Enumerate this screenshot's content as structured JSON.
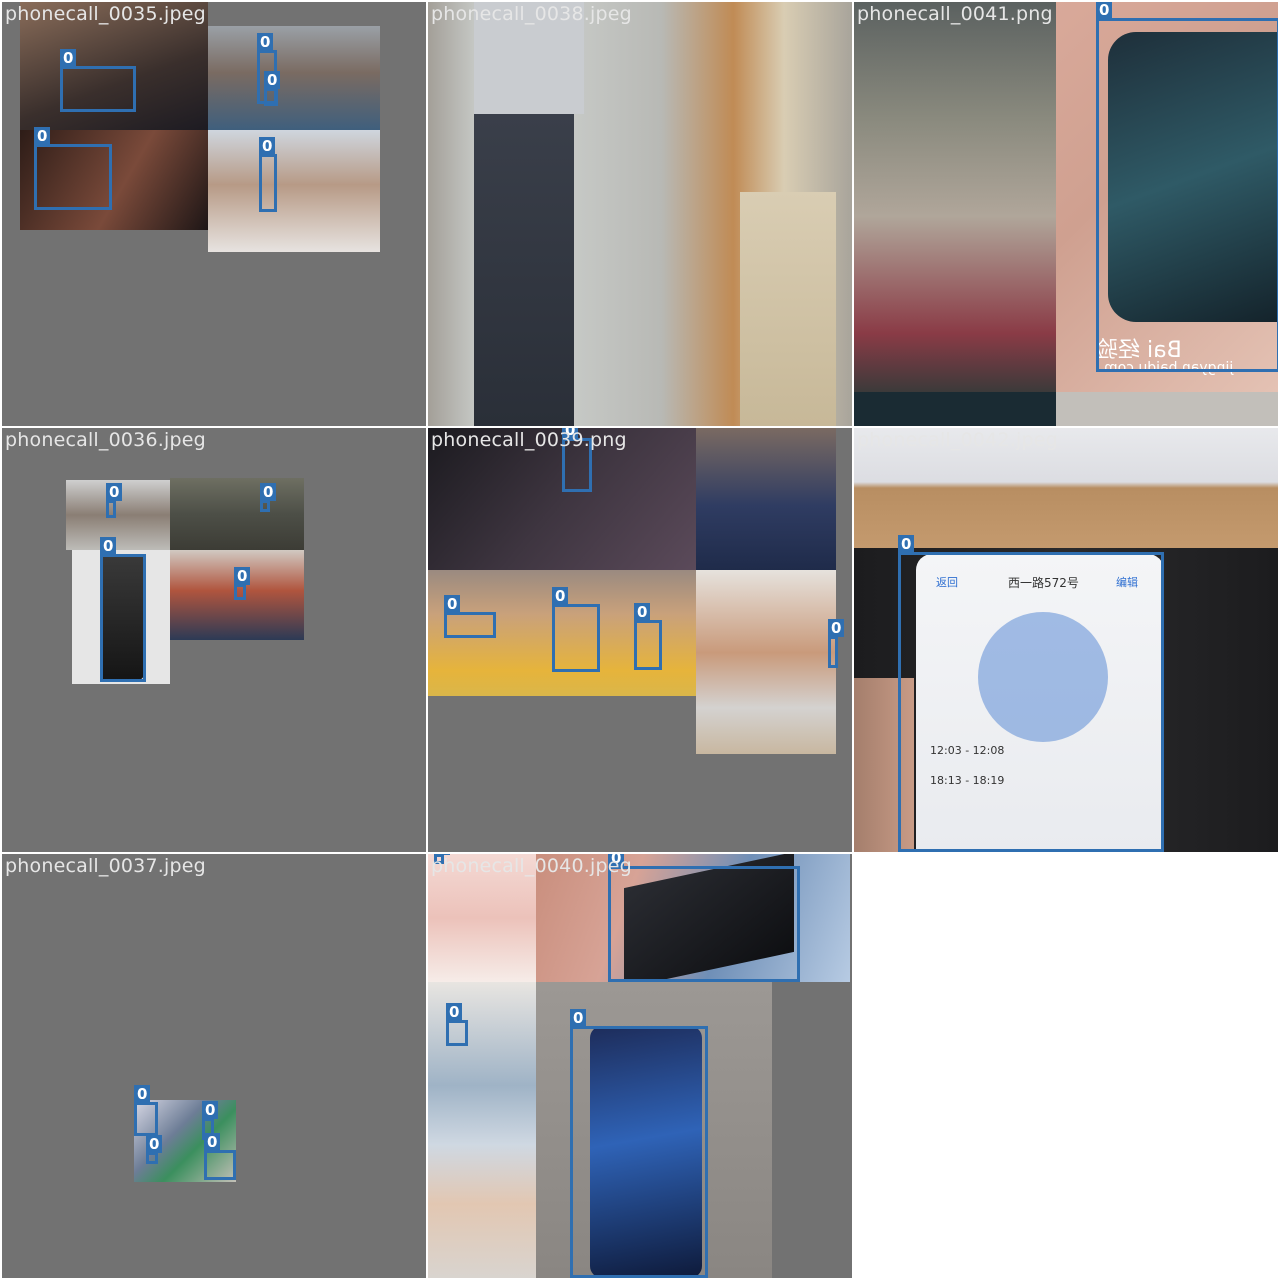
{
  "mosaic": {
    "class_label": "0",
    "box_color": "#2f6fb1",
    "tiles": [
      {
        "key": "t0035",
        "filename": "phonecall_0035.jpeg"
      },
      {
        "key": "t0038",
        "filename": "phonecall_0038.jpeg"
      },
      {
        "key": "t0041",
        "filename": "phonecall_0041.png"
      },
      {
        "key": "t0036",
        "filename": "phonecall_0036.jpeg"
      },
      {
        "key": "t0039",
        "filename": "phonecall_0039.png"
      },
      {
        "key": "t0042",
        "filename": "phonecall_0042.jpeg"
      },
      {
        "key": "t0037",
        "filename": "phonecall_0037.jpeg"
      },
      {
        "key": "t0040",
        "filename": "phonecall_0040.jpeg"
      }
    ]
  },
  "watermarks": {
    "baidu_1": "Bai 经验",
    "baidu_2": "jingyan.baidu.com"
  },
  "map_screen": {
    "title": "西一路572号",
    "back": "返回",
    "edit": "编辑",
    "time1": "12:03 - 12:08",
    "time2": "18:13 - 18:19"
  }
}
